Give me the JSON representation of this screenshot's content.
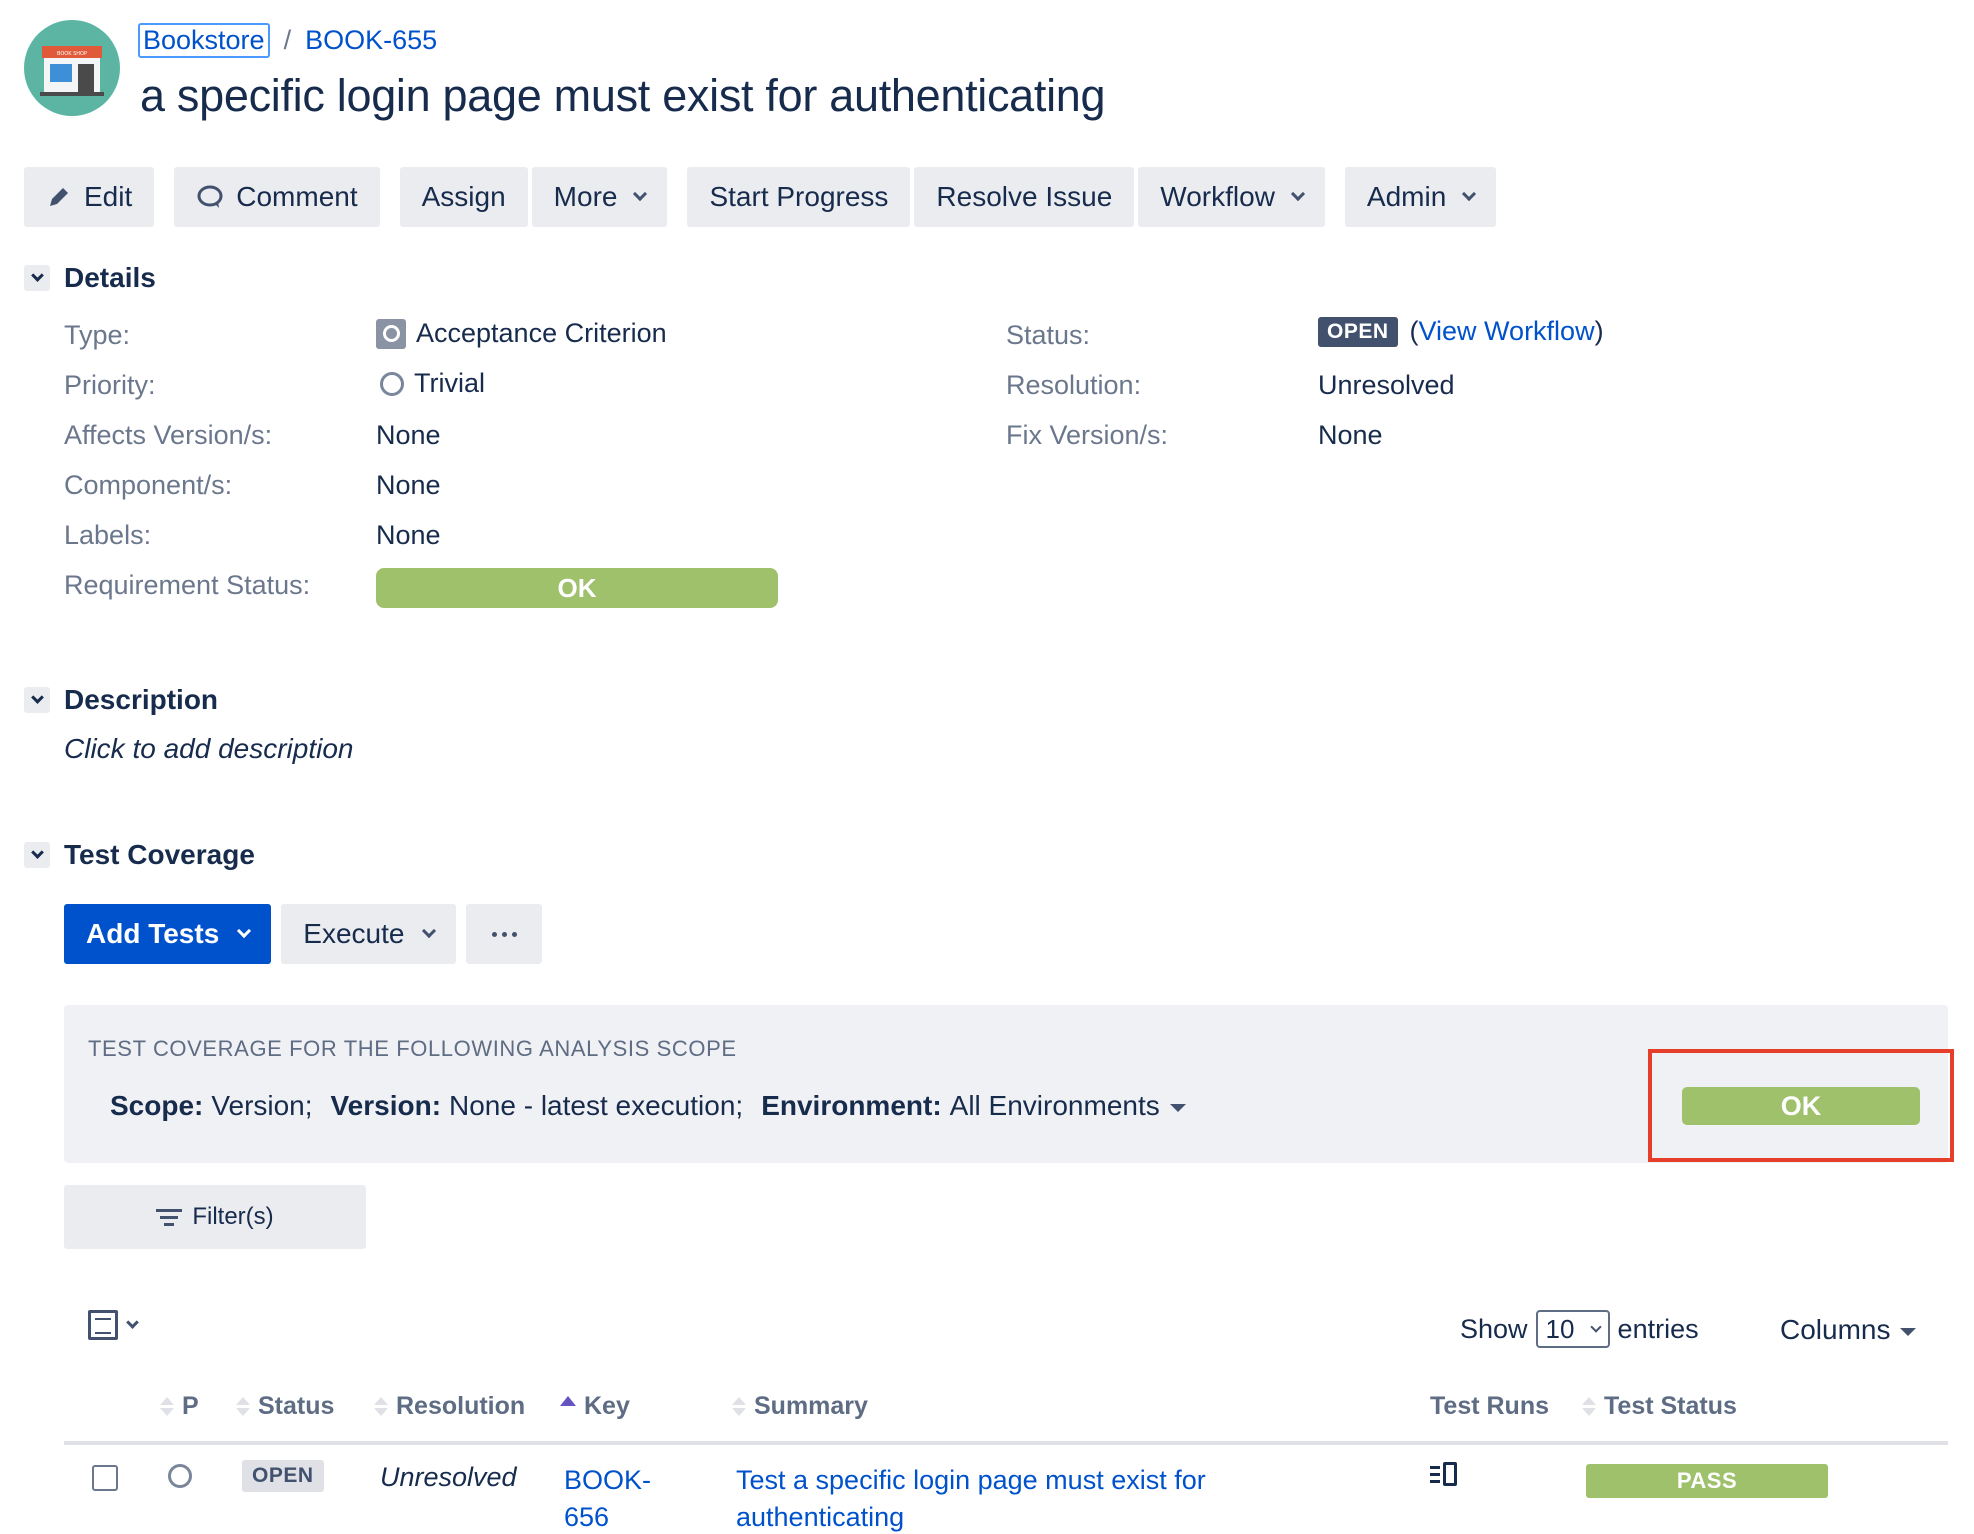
{
  "breadcrumb": {
    "project": "Bookstore",
    "separator": "/",
    "issue_key": "BOOK-655"
  },
  "avatar": {
    "sign_text": "BOOK SHOP"
  },
  "title": "a specific login page must exist for authenticating",
  "toolbar": {
    "edit": "Edit",
    "comment": "Comment",
    "assign": "Assign",
    "more": "More",
    "start_progress": "Start Progress",
    "resolve_issue": "Resolve Issue",
    "workflow": "Workflow",
    "admin": "Admin"
  },
  "details": {
    "heading": "Details",
    "type_label": "Type:",
    "type_value": "Acceptance Criterion",
    "priority_label": "Priority:",
    "priority_value": "Trivial",
    "affects_label": "Affects Version/s:",
    "affects_value": "None",
    "component_label": "Component/s:",
    "component_value": "None",
    "labels_label": "Labels:",
    "labels_value": "None",
    "req_status_label": "Requirement Status:",
    "req_status_value": "OK",
    "status_label": "Status:",
    "status_value": "OPEN",
    "view_workflow_open": "(",
    "view_workflow": "View Workflow",
    "view_workflow_close": ")",
    "resolution_label": "Resolution:",
    "resolution_value": "Unresolved",
    "fix_label": "Fix Version/s:",
    "fix_value": "None"
  },
  "description": {
    "heading": "Description",
    "placeholder": "Click to add description"
  },
  "test_coverage": {
    "heading": "Test Coverage",
    "add_tests": "Add Tests",
    "execute": "Execute",
    "scope_heading": "TEST COVERAGE FOR THE FOLLOWING ANALYSIS SCOPE",
    "scope_label": "Scope:",
    "scope_value": "Version;",
    "version_label": "Version:",
    "version_value": "None - latest execution;",
    "environment_label": "Environment:",
    "environment_value": "All Environments",
    "coverage_status": "OK",
    "filters": "Filter(s)",
    "show": "Show",
    "entries_count": "10",
    "entries": "entries",
    "columns": "Columns"
  },
  "table": {
    "headers": {
      "p": "P",
      "status": "Status",
      "resolution": "Resolution",
      "key": "Key",
      "summary": "Summary",
      "test_runs": "Test Runs",
      "test_status": "Test Status"
    },
    "rows": [
      {
        "status": "OPEN",
        "resolution": "Unresolved",
        "key": "BOOK-656",
        "summary": "Test a specific login page must exist for authenticating",
        "test_status": "PASS"
      }
    ]
  },
  "colors": {
    "link": "#0052cc",
    "ok_green": "#9fc16c",
    "highlight": "#e53e2a",
    "open_lozenge": "#42526e"
  }
}
